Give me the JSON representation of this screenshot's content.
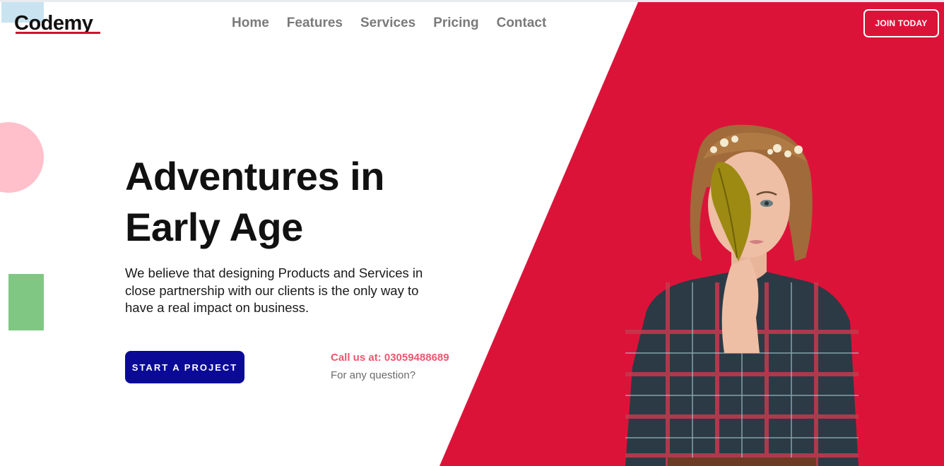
{
  "brand": {
    "logo_text": "Codemy",
    "accent_color": "#dc1339"
  },
  "nav": {
    "items": [
      "Home",
      "Features",
      "Services",
      "Pricing",
      "Contact"
    ],
    "join_label": "JOIN TODAY"
  },
  "hero": {
    "title_line1": "Adventures in",
    "title_line2": "Early Age",
    "description": "We believe that designing Products and Services in close partnership with our clients is the only way to have a real impact on business.",
    "cta_label": "START A PROJECT",
    "call_text": "Call us at: 03059488689",
    "call_sub": "For any question?"
  },
  "icons": {
    "hero_image": "woman-holding-leaf-photo"
  }
}
